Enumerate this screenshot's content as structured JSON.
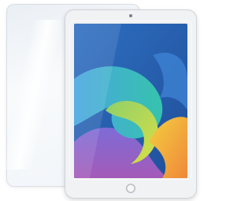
{
  "colors": {
    "background": "#ffffff",
    "tablet_frame": "#f1f2f4",
    "wallpaper_blue": "#2b6fb8",
    "wallpaper_teal": "#39b7a8",
    "wallpaper_green": "#c6d84a",
    "wallpaper_yellow": "#f2c53c",
    "wallpaper_orange": "#f08a3a",
    "wallpaper_purple": "#8d5fc4"
  },
  "icons": {
    "home_button": "home-button-icon",
    "camera": "front-camera-icon"
  }
}
